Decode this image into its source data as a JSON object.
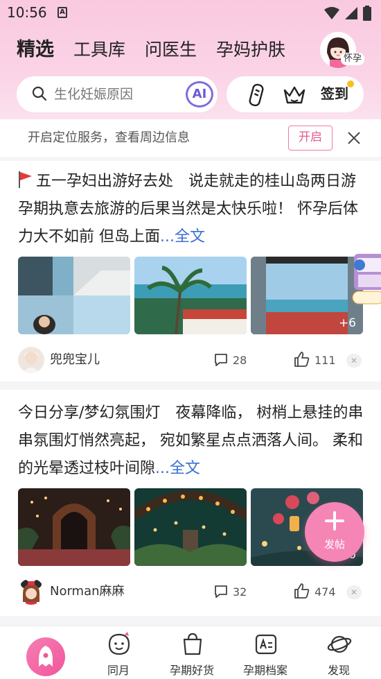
{
  "status_bar": {
    "time": "10:56",
    "app_badge": "A"
  },
  "header": {
    "tabs": [
      {
        "label": "精选",
        "active": true
      },
      {
        "label": "工具库"
      },
      {
        "label": "问医生"
      },
      {
        "label": "孕妈护肤"
      }
    ],
    "stage_label": "怀孕"
  },
  "search": {
    "placeholder": "生化妊娠原因",
    "ai_label": "AI"
  },
  "tools": {
    "checkin_label": "签到"
  },
  "location_banner": {
    "text": "开启定位服务，查看周边信息",
    "button": "开启"
  },
  "posts": [
    {
      "text": "五一孕妇出游好去处　说走就走的桂山岛两日游  孕期执意去旅游的后果当然是太快乐啦！  怀孕后体力大不如前  但岛上面",
      "more": "...全文",
      "photo_more": "+6",
      "author": "兜兜宝儿",
      "comments": "28",
      "likes": "111"
    },
    {
      "text": "今日分享/梦幻氛围灯　夜幕降临，  树梢上悬挂的串串氛围灯悄然亮起，  宛如繁星点点洒落人间。  柔和的光晕透过枝叶间隙",
      "more": "...全文",
      "photo_more": "+6",
      "author": "Norman麻麻",
      "comments": "32",
      "likes": "474"
    }
  ],
  "fab": {
    "label": "发帖"
  },
  "bottom_nav": [
    {
      "label": ""
    },
    {
      "label": "同月"
    },
    {
      "label": "孕期好货"
    },
    {
      "label": "孕期档案"
    },
    {
      "label": "发现"
    }
  ],
  "colors": {
    "accent": "#f2559a",
    "link": "#3a6fd0",
    "ai": "#6a5ad8"
  }
}
